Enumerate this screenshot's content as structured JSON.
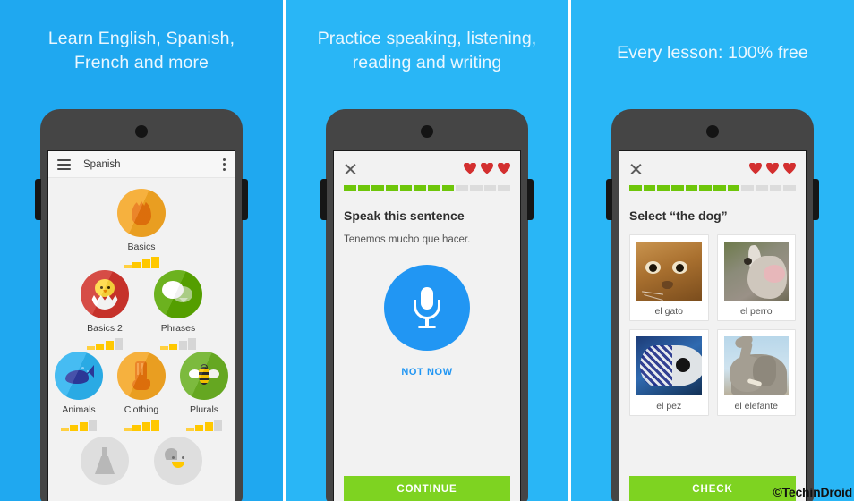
{
  "meta": {
    "accent_blue": "#29b6f6",
    "green": "#7ed321",
    "gold": "#ffc800",
    "heart_red": "#d32f2f",
    "mic_blue": "#2196f3",
    "watermark": "©TechinDroid"
  },
  "panels": [
    {
      "id": "panel-learn-languages",
      "headline": "Learn English, Spanish, French and more",
      "headline_lines": [
        "Learn English, Spanish,",
        "French and more"
      ],
      "appbar": {
        "menu_icon": "hamburger-icon",
        "title": "Spanish",
        "overflow_icon": "kebab-menu-icon"
      },
      "skill_rows": [
        [
          {
            "name": "Basics",
            "icon": "egg-icon",
            "color": "#f5a623",
            "strength_filled": 4,
            "strength_total": 4,
            "locked": false
          }
        ],
        [
          {
            "name": "Basics 2",
            "icon": "chick-icon",
            "color": "#d0342c",
            "strength_filled": 3,
            "strength_total": 4,
            "locked": false
          },
          {
            "name": "Phrases",
            "icon": "speech-bubbles-icon",
            "color": "#58a700",
            "strength_filled": 2,
            "strength_total": 4,
            "locked": false
          }
        ],
        [
          {
            "name": "Animals",
            "icon": "whale-icon",
            "color": "#2cb3f0",
            "strength_filled": 3,
            "strength_total": 4,
            "locked": false
          },
          {
            "name": "Clothing",
            "icon": "sock-icon",
            "color": "#f5a623",
            "strength_filled": 4,
            "strength_total": 4,
            "locked": false
          },
          {
            "name": "Plurals",
            "icon": "bee-icon",
            "color": "#6ab023",
            "strength_filled": 3,
            "strength_total": 4,
            "locked": false
          }
        ],
        [
          {
            "name": "",
            "icon": "flask-icon",
            "color": "#dedede",
            "strength_filled": 0,
            "strength_total": 0,
            "locked": true
          },
          {
            "name": "",
            "icon": "heart-face-icon",
            "color": "#dedede",
            "strength_filled": 0,
            "strength_total": 0,
            "locked": true
          }
        ]
      ]
    },
    {
      "id": "panel-practice-skills",
      "headline": "Practice speaking, listening, reading and writing",
      "headline_lines": [
        "Practice speaking, listening,",
        "reading and writing"
      ],
      "lesson": {
        "close_icon": "close-x-icon",
        "hearts": 3,
        "progress_filled": 8,
        "progress_total": 12,
        "prompt": "Speak this sentence",
        "sentence": "Tenemos mucho que hacer.",
        "mic_icon": "microphone-icon",
        "skip_label": "NOT NOW",
        "cta_label": "CONTINUE"
      }
    },
    {
      "id": "panel-free-lessons",
      "headline": "Every lesson: 100% free",
      "headline_lines": [
        "Every lesson: 100% free"
      ],
      "lesson": {
        "close_icon": "close-x-icon",
        "hearts": 3,
        "progress_filled": 8,
        "progress_total": 12,
        "prompt": "Select “the dog”",
        "cta_label": "CHECK",
        "cards": [
          {
            "label": "el gato",
            "photo": "cat-photo"
          },
          {
            "label": "el perro",
            "photo": "dog-photo"
          },
          {
            "label": "el pez",
            "photo": "fish-photo"
          },
          {
            "label": "el elefante",
            "photo": "elephant-photo"
          }
        ]
      }
    }
  ]
}
